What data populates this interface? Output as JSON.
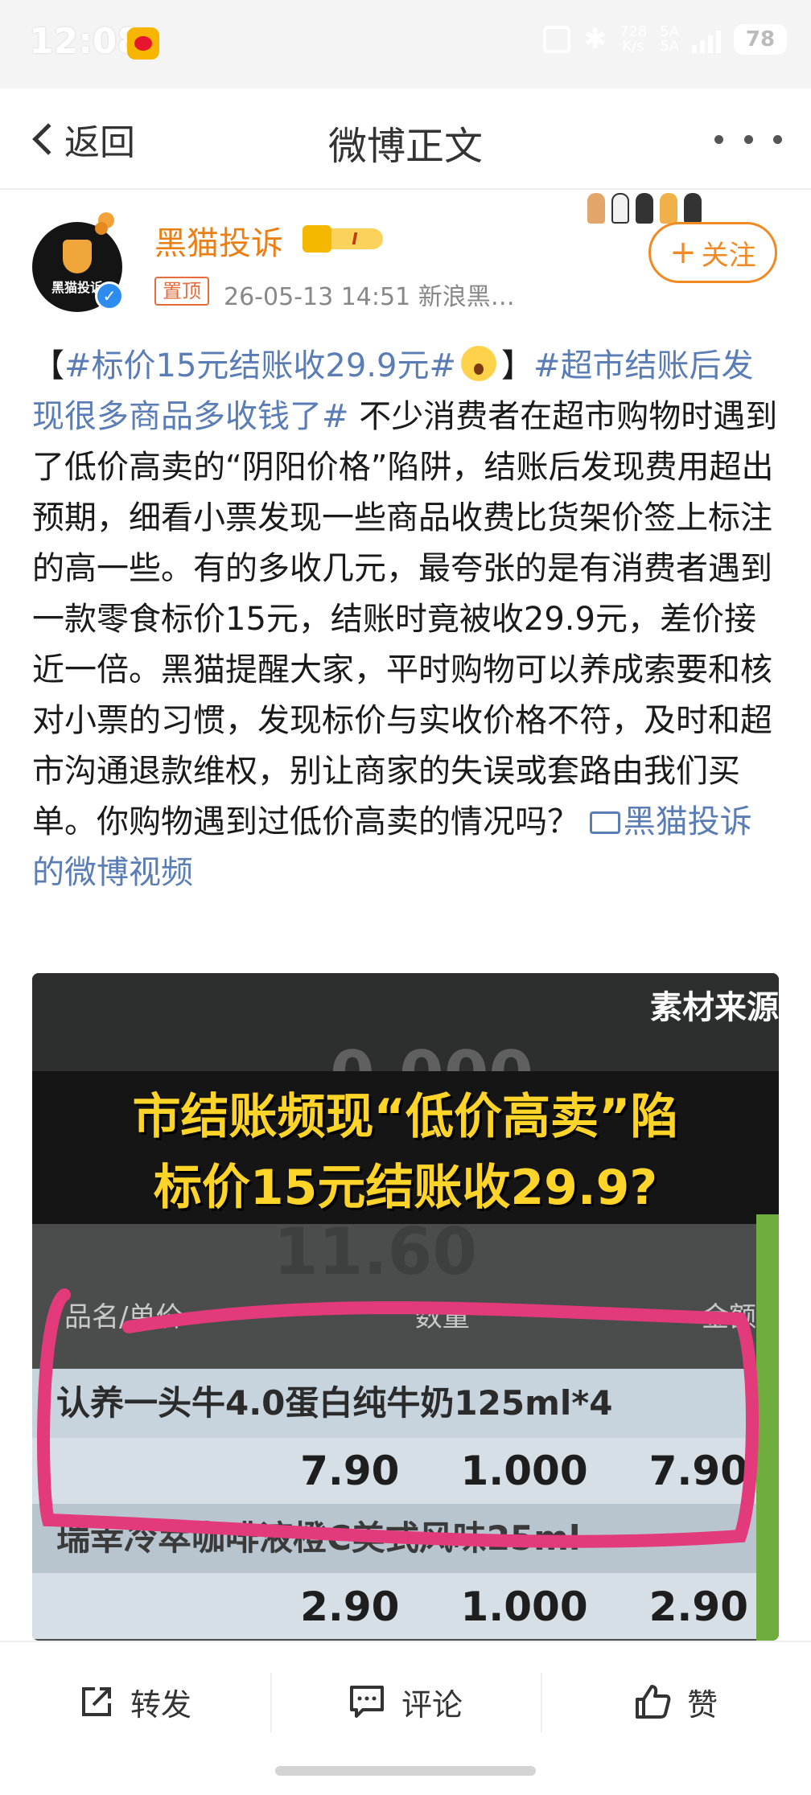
{
  "status_bar": {
    "time": "12:08",
    "speed_top": "728",
    "speed_bottom": "K/s",
    "signal_label_1": "5A",
    "signal_label_2": "5A",
    "battery": "78"
  },
  "nav": {
    "back_label": "返回",
    "title": "微博正文"
  },
  "author": {
    "name": "黑猫投诉",
    "avatar_text": "黑猫投诉",
    "member_level": "I",
    "pin_label": "置顶",
    "meta": "26-05-13 14:51  新浪黑…",
    "follow_label": "关注"
  },
  "post": {
    "bracket_open": "【",
    "topic_1": "#标价15元结账收29.9元#",
    "bracket_close": "】",
    "topic_2": "#超市结账后发现很多商品多收钱了#",
    "text": " 不少消费者在超市购物时遇到了低价高卖的“阴阳价格”陷阱，结账后发现费用超出预期，细看小票发现一些商品收费比货架价签上标注的高一些。有的多收几元，最夸张的是有消费者遇到一款零食标价15元，结账时竟被收29.9元，差价接近一倍。黑猫提醒大家，平时购物可以养成索要和核对小票的习惯，发现标价与实收价格不符，及时和超市沟通退款维权，别让商家的失误或套路由我们买单。你购物遇到过低价高卖的情况吗？ ",
    "video_link": "黑猫投诉的微博视频"
  },
  "video": {
    "source_label": "素材来源",
    "ghost_number": "0.000",
    "ghost_total": "11.60",
    "caption_line_1": "市结账频现“低价高卖”陷",
    "caption_line_2": "标价15元结账收29.9?",
    "header_name": "品名/单价",
    "header_qty": "数量",
    "header_amount": "金额",
    "row_1_name": "认养一头牛4.0蛋白纯牛奶125ml*4",
    "row_1_price": "7.90",
    "row_1_qty": "1.000",
    "row_1_amount": "7.90",
    "row_2_name": "瑞幸冷萃咖啡液橙C美式风味25ml",
    "row_2_price": "2.90",
    "row_2_qty": "1.000",
    "row_2_amount": "2.90",
    "highlight_color": "#e23a7a"
  },
  "actions": {
    "repost": "转发",
    "comment": "评论",
    "like": "赞"
  },
  "colors": {
    "accent_orange": "#f08a24",
    "link_blue": "#5b7db5",
    "caption_yellow": "#ffd429"
  }
}
